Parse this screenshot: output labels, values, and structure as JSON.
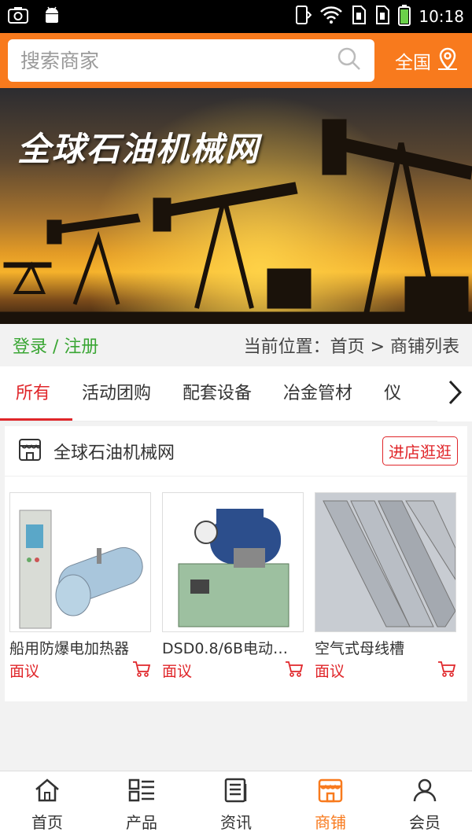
{
  "status_bar": {
    "time": "10:18"
  },
  "search": {
    "placeholder": "搜索商家",
    "region_label": "全国"
  },
  "banner": {
    "title": "全球石油机械网"
  },
  "login_bar": {
    "login_label": "登录 / 注册",
    "breadcrumb": "当前位置：首页 > 商铺列表"
  },
  "tabs": [
    {
      "label": "所有",
      "active": true
    },
    {
      "label": "活动团购"
    },
    {
      "label": "配套设备"
    },
    {
      "label": "冶金管材"
    },
    {
      "label": "仪"
    }
  ],
  "shop": {
    "name": "全球石油机械网",
    "enter_button": "进店逛逛",
    "products": [
      {
        "name": "船用防爆电加热器",
        "price": "面议"
      },
      {
        "name": "DSD0.8/6B电动…",
        "price": "面议"
      },
      {
        "name": "空气式母线槽",
        "price": "面议"
      }
    ]
  },
  "bottom_nav": [
    {
      "label": "首页",
      "icon": "home-icon"
    },
    {
      "label": "产品",
      "icon": "grid-list-icon"
    },
    {
      "label": "资讯",
      "icon": "news-icon"
    },
    {
      "label": "商铺",
      "icon": "store-icon",
      "active": true
    },
    {
      "label": "会员",
      "icon": "user-icon"
    }
  ],
  "colors": {
    "accent": "#f87a1d",
    "red": "#e0262a",
    "green": "#3aa634"
  }
}
